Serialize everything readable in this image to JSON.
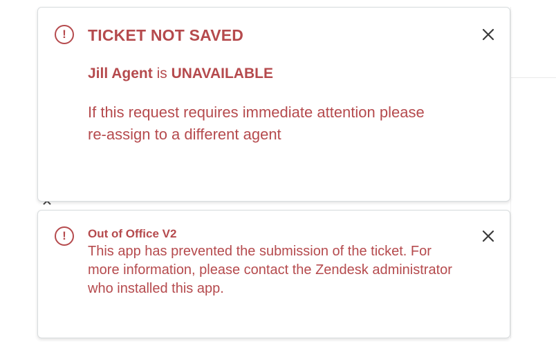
{
  "notifications": [
    {
      "title": "TICKET NOT SAVED",
      "agent_name": "Jill Agent",
      "status_connector": " is ",
      "status": "UNAVAILABLE",
      "message": "If this request requires immediate attention please re-assign to a different agent",
      "icon": "alert-circle-icon",
      "close_icon": "close-icon"
    },
    {
      "title": "Out of Office V2",
      "message": "This app has prevented the submission of the ticket. For more information, please contact the Zendesk administrator who installed this app.",
      "icon": "alert-circle-icon",
      "close_icon": "close-icon"
    }
  ],
  "colors": {
    "alert_text": "#b54a4d",
    "border": "#d8dcde",
    "close": "#3a3a3a"
  }
}
